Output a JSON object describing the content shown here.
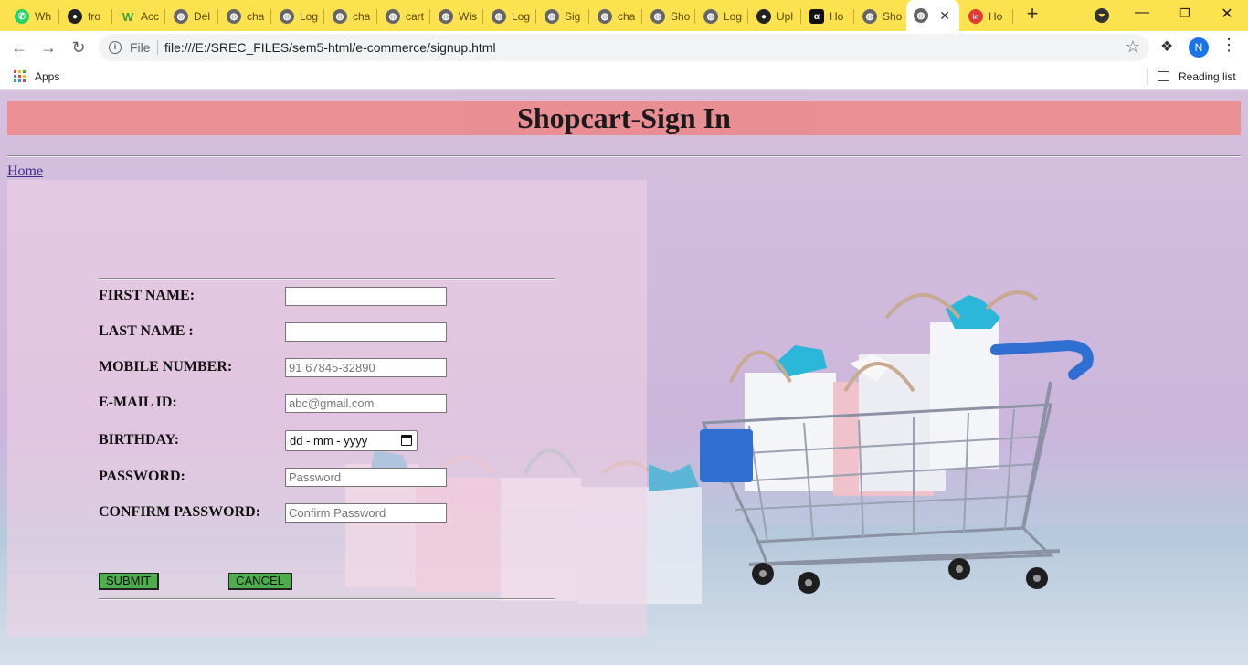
{
  "browser": {
    "tabs": [
      {
        "label": "Wh",
        "icon": "whatsapp-icon",
        "color": "#25d366"
      },
      {
        "label": "fro",
        "icon": "github-icon",
        "color": "#222222"
      },
      {
        "label": "Acc",
        "icon": "w-logo-icon",
        "color": "#3aa13a"
      },
      {
        "label": "Del",
        "icon": "globe-icon",
        "color": "#555555"
      },
      {
        "label": "cha",
        "icon": "globe-icon",
        "color": "#555555"
      },
      {
        "label": "Log",
        "icon": "globe-icon",
        "color": "#555555"
      },
      {
        "label": "cha",
        "icon": "globe-icon",
        "color": "#555555"
      },
      {
        "label": "cart",
        "icon": "globe-icon",
        "color": "#555555"
      },
      {
        "label": "Wis",
        "icon": "globe-icon",
        "color": "#555555"
      },
      {
        "label": "Log",
        "icon": "globe-icon",
        "color": "#555555"
      },
      {
        "label": "Sig",
        "icon": "globe-icon",
        "color": "#555555"
      },
      {
        "label": "cha",
        "icon": "globe-icon",
        "color": "#555555"
      },
      {
        "label": "Sho",
        "icon": "globe-icon",
        "color": "#555555"
      },
      {
        "label": "Log",
        "icon": "globe-icon",
        "color": "#555555"
      },
      {
        "label": "Upl",
        "icon": "github-icon",
        "color": "#222222"
      },
      {
        "label": "Ho",
        "icon": "alpha-icon",
        "color": "#111111"
      },
      {
        "label": "Sho",
        "icon": "globe-icon",
        "color": "#555555"
      },
      {
        "label": "",
        "icon": "globe-icon",
        "color": "#555555",
        "active": true
      },
      {
        "label": "Ho",
        "icon": "in-icon",
        "color": "#e53935"
      }
    ],
    "new_tab_label": "+",
    "url_scheme_label": "File",
    "url": "file:///E:/SREC_FILES/sem5-html/e-commerce/signup.html",
    "profile_initial": "N",
    "bookmarks": {
      "apps_label": "Apps",
      "reading_list_label": "Reading list"
    }
  },
  "page": {
    "title": "Shopcart-Sign In",
    "home_link": "Home",
    "form": {
      "fields": [
        {
          "label": "FIRST NAME:",
          "type": "text",
          "placeholder": ""
        },
        {
          "label": "LAST NAME :",
          "type": "text",
          "placeholder": ""
        },
        {
          "label": "MOBILE NUMBER:",
          "type": "text",
          "placeholder": "91 67845-32890"
        },
        {
          "label": "E-MAIL ID:",
          "type": "text",
          "placeholder": "abc@gmail.com"
        },
        {
          "label": "BIRTHDAY:",
          "type": "date",
          "placeholder": "dd - mm - yyyy"
        },
        {
          "label": "PASSWORD:",
          "type": "password",
          "placeholder": "Password"
        },
        {
          "label": "CONFIRM PASSWORD:",
          "type": "password",
          "placeholder": "Confirm Password"
        }
      ],
      "submit_label": "SUBMIT",
      "cancel_label": "CANCEL"
    }
  },
  "colors": {
    "tabstrip": "#fde24f",
    "header_bar": "#eb8c8f",
    "button": "#4cae4c"
  }
}
